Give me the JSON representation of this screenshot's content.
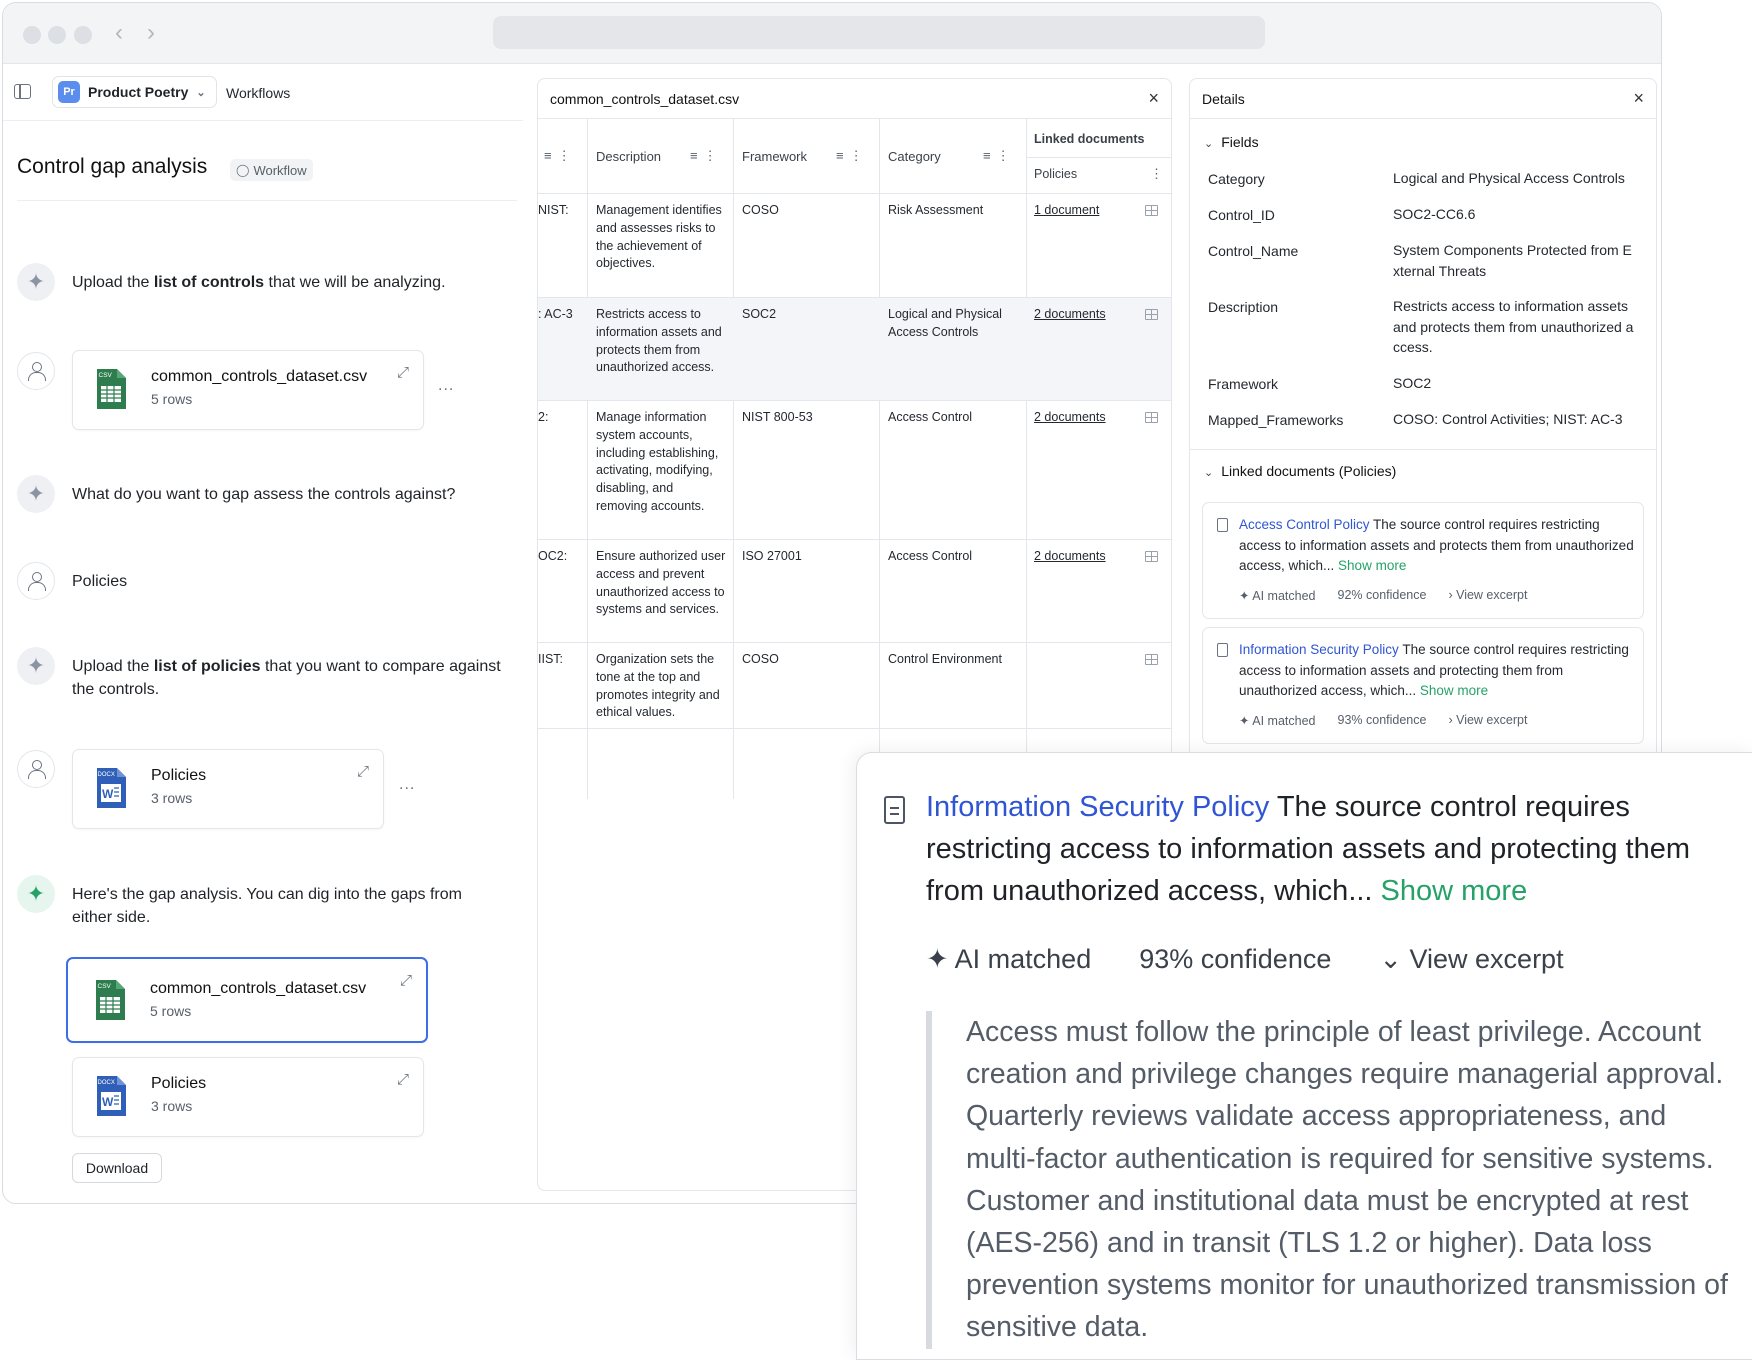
{
  "header": {
    "workspace_initials": "Pr",
    "workspace_name": "Product Poetry",
    "breadcrumb": "Workflows"
  },
  "chat": {
    "title": "Control gap analysis",
    "badge": "Workflow",
    "msg1": {
      "pre": "Upload the ",
      "bold": "list of controls",
      "post": " that we will be analyzing."
    },
    "file1": {
      "name": "common_controls_dataset.csv",
      "rows": "5 rows"
    },
    "msg2": "What do you want to gap assess the controls against?",
    "msg3": "Policies",
    "msg4": {
      "pre": "Upload the ",
      "bold": "list of policies",
      "post": " that you want to compare against the controls."
    },
    "file2": {
      "name": "Policies",
      "rows": "3 rows"
    },
    "msg5": "Here's the gap analysis. You can dig into the gaps from either side.",
    "file3": {
      "name": "common_controls_dataset.csv",
      "rows": "5 rows"
    },
    "file4": {
      "name": "Policies",
      "rows": "3 rows"
    },
    "more": "...",
    "download": "Download"
  },
  "table": {
    "title": "common_controls_dataset.csv",
    "headers": {
      "description": "Description",
      "framework": "Framework",
      "category": "Category",
      "linked": "Linked documents",
      "policies": "Policies"
    },
    "rows": [
      {
        "frag": "NIST:",
        "description": "Management identifies and assesses risks to the achievement of objectives.",
        "framework": "COSO",
        "category": "Risk Assessment",
        "docs": "1 document"
      },
      {
        "frag": ": AC-3",
        "description": "Restricts access to information assets and protects them from unauthorized access.",
        "framework": "SOC2",
        "category": "Logical and Physical Access Controls",
        "docs": "2 documents"
      },
      {
        "frag": "2:",
        "description": "Manage information system accounts, including establishing, activating, modifying, disabling, and removing accounts.",
        "framework": "NIST 800-53",
        "category": "Access Control",
        "docs": "2 documents"
      },
      {
        "frag": "OC2:",
        "description": "Ensure authorized user access and prevent unauthorized access to systems and services.",
        "framework": "ISO 27001",
        "category": "Access Control",
        "docs": "2 documents"
      },
      {
        "frag": "IIST:",
        "description": "Organization sets the tone at the top and promotes integrity and ethical values.",
        "framework": "COSO",
        "category": "Control Environment",
        "docs": ""
      }
    ]
  },
  "details": {
    "title": "Details",
    "fields_title": "Fields",
    "fields": [
      {
        "label": "Category",
        "value": "Logical and Physical Access Controls"
      },
      {
        "label": "Control_ID",
        "value": "SOC2-CC6.6"
      },
      {
        "label": "Control_Name",
        "value": "System Components Protected from External Threats"
      },
      {
        "label": "Description",
        "value": "Restricts access to information assets and protects them from unauthorized access."
      },
      {
        "label": "Framework",
        "value": "SOC2"
      },
      {
        "label": "Mapped_Frameworks",
        "value": "COSO: Control Activities; NIST: AC-3"
      }
    ],
    "linked_title": "Linked documents (Policies)",
    "linked": [
      {
        "name": "Access Control Policy",
        "text": " The source control requires restricting access to information assets and protects them from unauthorized access, which... ",
        "show_more": "Show more",
        "ai": "AI matched",
        "confidence": "92% confidence",
        "excerpt": "View excerpt"
      },
      {
        "name": "Information Security Policy",
        "text": " The source control requires restricting access to information assets and protecting them from unauthorized access, which... ",
        "show_more": "Show more",
        "ai": "AI matched",
        "confidence": "93% confidence",
        "excerpt": "View excerpt"
      }
    ]
  },
  "zoom": {
    "name": "Information Security Policy",
    "text": " The source control requires restricting access to information assets and protecting them from unauthorized access, which... ",
    "show_more": "Show more",
    "ai": "AI matched",
    "confidence": "93% confidence",
    "excerpt": "View excerpt",
    "quote": "Access must follow the principle of least privilege. Account creation and privilege changes require managerial approval. Quarterly reviews validate access appropriateness, and multi-factor authentication is required for sensitive systems. Customer and institutional data must be encrypted at rest (AES-256) and in transit (TLS 1.2 or higher). Data loss prevention systems monitor for unauthorized transmission of sensitive data."
  },
  "colors": {
    "accent": "#2f55d4",
    "success": "#26a269",
    "selected_border": "#3b6ee8"
  },
  "icons": [
    "sidebar-toggle-icon",
    "chevron-down-icon",
    "workflow-icon",
    "sparkle-icon",
    "user-icon",
    "csv-file-icon",
    "docx-file-icon",
    "expand-icon",
    "filter-icon",
    "kebab-icon",
    "grid-icon",
    "close-icon",
    "document-icon"
  ]
}
